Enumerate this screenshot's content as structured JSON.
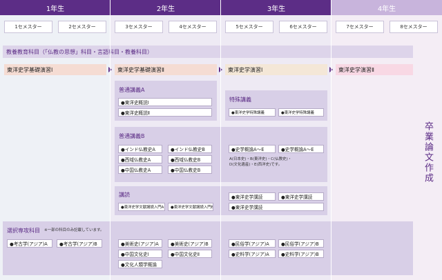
{
  "years": [
    "1年生",
    "2年生",
    "3年生",
    "4年生"
  ],
  "semesters": [
    "1セメスター",
    "2セメスター",
    "3セメスター",
    "4セメスター",
    "5セメスター",
    "6セメスター",
    "7セメスター",
    "8セメスター"
  ],
  "general_education": "教養教育科目（「仏教の思想」科目・言語科目・教養科目）",
  "seminars": {
    "basic_1": "東洋史学基礎演習Ⅰ",
    "basic_2": "東洋史学基礎演習Ⅱ",
    "seminar_1": "東洋史学演習Ⅰ",
    "seminar_2": "東洋史学演習Ⅱ"
  },
  "general_lectures_a": {
    "title": "普通講義A",
    "items": [
      "●東洋史概説Ⅰ",
      "●東洋史概説Ⅱ"
    ]
  },
  "special_lectures": {
    "title": "特殊講義",
    "items": [
      "●東洋史学特殊講義",
      "●東洋史学特殊講義"
    ]
  },
  "general_lectures_b": {
    "title": "普通講義B",
    "year2": [
      "●インド仏教史A",
      "●インド仏教史B",
      "●西域仏教史A",
      "●西域仏教史B",
      "●中国仏教史A",
      "●中国仏教史B"
    ],
    "year3": [
      "●史学概論A～E",
      "●史学概論A～E"
    ],
    "note_1": "A(日本史)・B(東洋史)・C(仏教史)・",
    "note_2": "D(文化遺産)・E(西洋史)です。"
  },
  "readings": {
    "title": "講読",
    "year2": [
      "●東洋史学文献講読入門A",
      "●東洋史学文献講読入門B"
    ],
    "year3": [
      "●東洋史学講読",
      "●東洋史学講読",
      "●東洋史学講読"
    ]
  },
  "electives": {
    "title": "選択専攻科目",
    "note": "※一部の科目のみ記載しています。",
    "year1": [
      "●考古学(アジア)A",
      "●考古学(アジア)B"
    ],
    "year2": [
      "●美術史(アジア)A",
      "●美術史(アジア)B",
      "●中国文化史Ⅰ",
      "●中国文化史Ⅱ",
      "●文化人類学概論"
    ],
    "year3": [
      "●民俗学(アジア)A",
      "●民俗学(アジア)B",
      "●史料学(アジア)A",
      "●史料学(アジア)B"
    ]
  },
  "graduation_thesis": "卒業論文作成",
  "colors": {
    "header": "#5c2d86",
    "header_year4": "#c8b4dc",
    "band": "#ddd4ea",
    "panel": "#d8cfe7"
  }
}
